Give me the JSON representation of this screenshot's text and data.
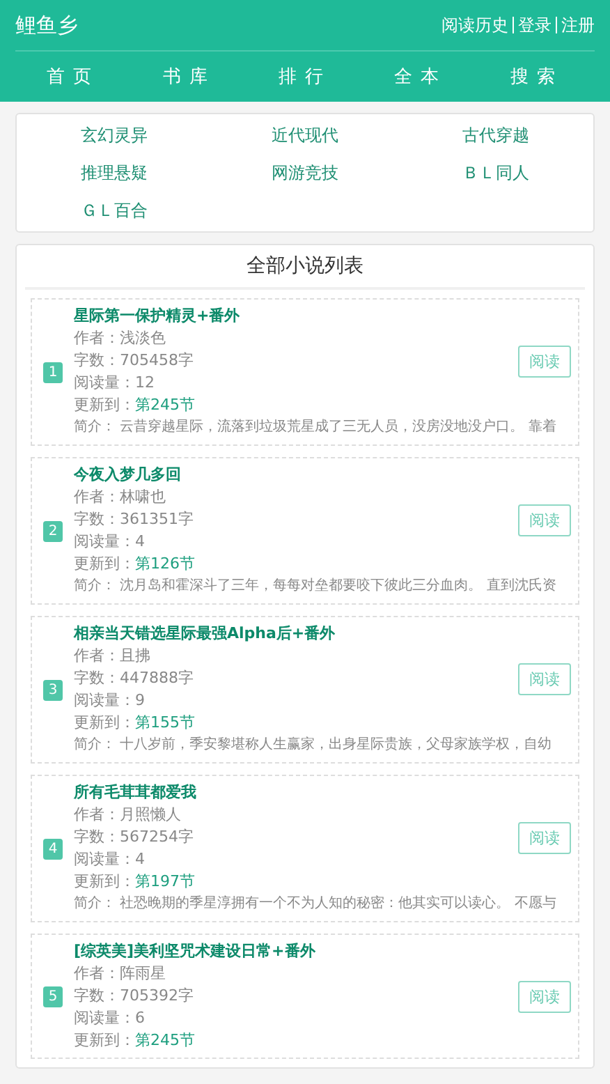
{
  "site": {
    "title": "鲤鱼乡",
    "links": [
      "阅读历史",
      "登录",
      "注册"
    ]
  },
  "nav": [
    {
      "label": "首页"
    },
    {
      "label": "书库"
    },
    {
      "label": "排行"
    },
    {
      "label": "全本"
    },
    {
      "label": "搜索"
    }
  ],
  "categories": [
    "玄幻灵异",
    "近代现代",
    "古代穿越",
    "推理悬疑",
    "网游竞技",
    "ＢＬ同人",
    "ＧＬ百合"
  ],
  "list": {
    "title": "全部小说列表",
    "items": [
      {
        "rank": "1",
        "title": "星际第一保护精灵+番外",
        "author_label": "作者：",
        "author": "浅淡色",
        "words_label": "字数：",
        "words": "705458字",
        "reads_label": "阅读量：",
        "reads": "12",
        "update_label": "更新到：",
        "update": "第245节",
        "intro_label": "简介：",
        "intro": "云昔穿越星际，流落到垃圾荒星成了三无人员，没房没地没户口。 靠着",
        "button": "阅读"
      },
      {
        "rank": "2",
        "title": "今夜入梦几多回",
        "author_label": "作者：",
        "author": "林啸也",
        "words_label": "字数：",
        "words": "361351字",
        "reads_label": "阅读量：",
        "reads": "4",
        "update_label": "更新到：",
        "update": "第126节",
        "intro_label": "简介：",
        "intro": "沈月岛和霍深斗了三年，每每对垒都要咬下彼此三分血肉。 直到沈氏资",
        "button": "阅读"
      },
      {
        "rank": "3",
        "title": "相亲当天错选星际最强Alpha后+番外",
        "author_label": "作者：",
        "author": "且拂",
        "words_label": "字数：",
        "words": "447888字",
        "reads_label": "阅读量：",
        "reads": "9",
        "update_label": "更新到：",
        "update": "第155节",
        "intro_label": "简介：",
        "intro": "十八岁前，季安黎堪称人生赢家，出身星际贵族，父母家族学权，自幼",
        "button": "阅读"
      },
      {
        "rank": "4",
        "title": "所有毛茸茸都爱我",
        "author_label": "作者：",
        "author": "月照懒人",
        "words_label": "字数：",
        "words": "567254字",
        "reads_label": "阅读量：",
        "reads": "4",
        "update_label": "更新到：",
        "update": "第197节",
        "intro_label": "简介：",
        "intro": "社恐晚期的季星淳拥有一个不为人知的秘密：他其实可以读心。 不愿与",
        "button": "阅读"
      },
      {
        "rank": "5",
        "title": "[综英美]美利坚咒术建设日常+番外",
        "author_label": "作者：",
        "author": "阵雨星",
        "words_label": "字数：",
        "words": "705392字",
        "reads_label": "阅读量：",
        "reads": "6",
        "update_label": "更新到：",
        "update": "第245节",
        "button": "阅读"
      }
    ]
  }
}
